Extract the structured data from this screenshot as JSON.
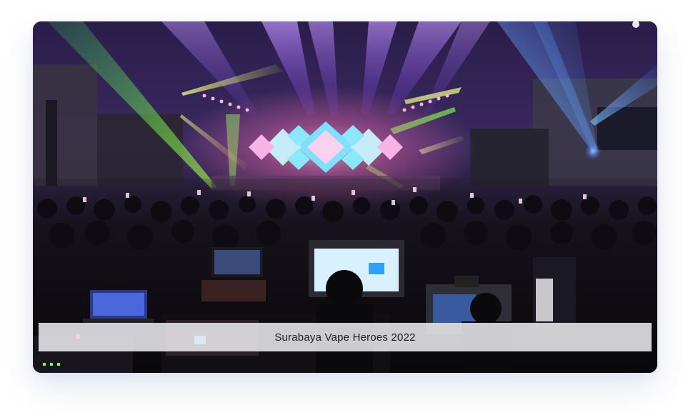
{
  "gallery": {
    "image": {
      "subject": "concert-stage-crowd-photo",
      "colors": {
        "stage_pink": "#ff6fb5",
        "beam_purple": "#a86cff",
        "beam_green": "#7dff4a",
        "beam_blue": "#4aa8ff",
        "beam_yellow": "#f5ff6a"
      }
    },
    "caption": "Surabaya Vape Heroes 2022"
  }
}
